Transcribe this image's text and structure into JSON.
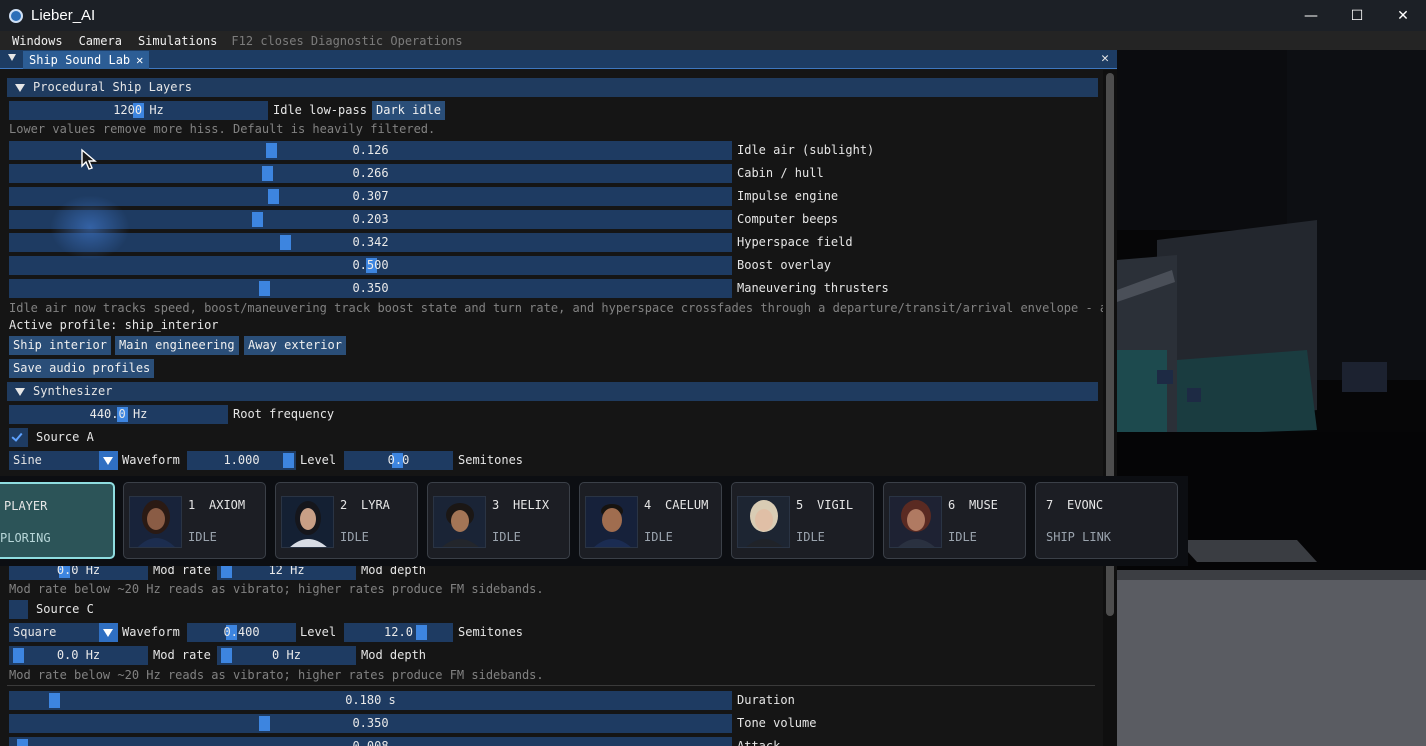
{
  "window": {
    "title": "Lieber_AI",
    "controls": [
      "—",
      "☐",
      "✕"
    ]
  },
  "menubar": {
    "items": [
      "Windows",
      "Camera",
      "Simulations"
    ],
    "note": "F12 closes Diagnostic Operations"
  },
  "panel": {
    "tab_label": "Ship Sound Lab",
    "close_glyph": "✕"
  },
  "layers": {
    "header": "Procedural Ship Layers",
    "idle_lowpass": {
      "value": "1200 Hz",
      "label": "Idle low-pass",
      "button": "Dark idle"
    },
    "hint": "Lower values remove more hiss. Default is heavily filtered.",
    "sliders": [
      {
        "value": "0.126",
        "label": "Idle air (sublight)"
      },
      {
        "value": "0.266",
        "label": "Cabin / hull"
      },
      {
        "value": "0.307",
        "label": "Impulse engine"
      },
      {
        "value": "0.203",
        "label": "Computer beeps"
      },
      {
        "value": "0.342",
        "label": "Hyperspace field"
      },
      {
        "value": "0.500",
        "label": "Boost overlay"
      },
      {
        "value": "0.350",
        "label": "Maneuvering thrusters"
      }
    ],
    "note": "Idle air now tracks speed, boost/maneuvering track boost state and turn rate, and hyperspace crossfades through a departure/transit/arrival envelope - adjus",
    "active_profile": "Active profile: ship_interior",
    "profile_buttons": [
      "Ship interior",
      "Main engineering",
      "Away exterior"
    ],
    "save_button": "Save audio profiles"
  },
  "synth": {
    "header": "Synthesizer",
    "root": {
      "value": "440.0 Hz",
      "label": "Root frequency"
    },
    "source_a": {
      "label": "Source A",
      "checked": true,
      "waveform": "Sine",
      "waveform_label": "Waveform",
      "level": "1.000",
      "level_label": "Level",
      "semitones": "0.0",
      "semitones_label": "Semitones"
    },
    "partial_row": {
      "mod_rate": "0.0 Hz",
      "mod_rate_label": "Mod rate",
      "mod_depth": "12 Hz",
      "mod_depth_label": "Mod depth"
    },
    "hint": "Mod rate below ~20 Hz reads as vibrato; higher rates produce FM sidebands.",
    "source_c": {
      "label": "Source C",
      "checked": false,
      "waveform": "Square",
      "waveform_label": "Waveform",
      "level": "0.400",
      "level_label": "Level",
      "semitones": "12.0",
      "semitones_label": "Semitones",
      "mod_rate": "0.0 Hz",
      "mod_rate_label": "Mod rate",
      "mod_depth": "0 Hz",
      "mod_depth_label": "Mod depth"
    },
    "hint2": "Mod rate below ~20 Hz reads as vibrato; higher rates produce FM sidebands.",
    "duration": {
      "value": "0.180 s",
      "label": "Duration"
    },
    "tone_volume": {
      "value": "0.350",
      "label": "Tone volume"
    },
    "attack": {
      "value": "0.008",
      "label": "Attack"
    }
  },
  "crew": [
    {
      "num": "",
      "name": "PLAYER",
      "status": "PLORING",
      "active": true,
      "portrait": "none"
    },
    {
      "num": "1",
      "name": "AXIOM",
      "status": "IDLE",
      "active": false,
      "portrait": "woman-dark-hair"
    },
    {
      "num": "2",
      "name": "LYRA",
      "status": "IDLE",
      "active": false,
      "portrait": "woman-white-uniform"
    },
    {
      "num": "3",
      "name": "HELIX",
      "status": "IDLE",
      "active": false,
      "portrait": "woman-short-hair"
    },
    {
      "num": "4",
      "name": "CAELUM",
      "status": "IDLE",
      "active": false,
      "portrait": "man-beard"
    },
    {
      "num": "5",
      "name": "VIGIL",
      "status": "IDLE",
      "active": false,
      "portrait": "woman-blonde"
    },
    {
      "num": "6",
      "name": "MUSE",
      "status": "IDLE",
      "active": false,
      "portrait": "woman-curly-hair"
    },
    {
      "num": "7",
      "name": "EVONC",
      "status": "SHIP LINK",
      "active": false,
      "portrait": "none"
    }
  ],
  "colors": {
    "accent": "#3d85e0",
    "header": "#1f3b5f",
    "frame": "#1e3b62",
    "crew_active": "#8fdde0"
  }
}
